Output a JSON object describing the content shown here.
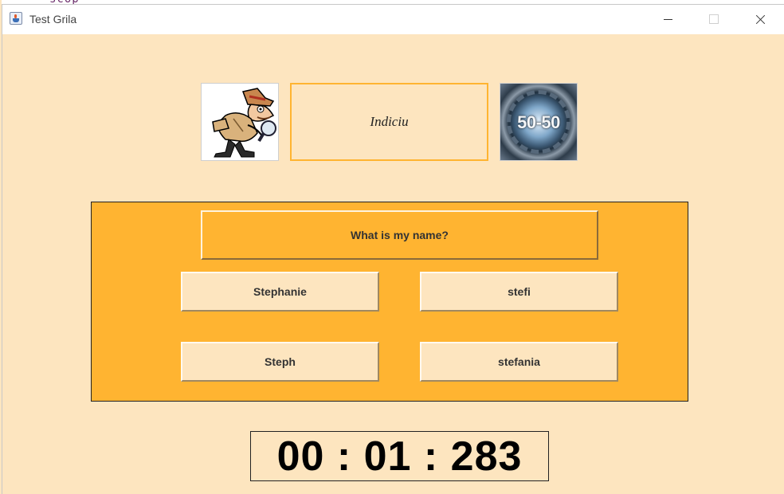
{
  "window": {
    "title": "Test Grila",
    "app_icon": "java-cup-icon"
  },
  "hint": {
    "icon": "detective-icon",
    "label": "Indiciu"
  },
  "fifty_fifty": {
    "icon": "fifty-fifty-icon",
    "label": "50-50"
  },
  "quiz": {
    "question": "What is my name?",
    "answers": [
      "Stephanie",
      "stefi",
      "Steph",
      "stefania"
    ]
  },
  "timer": {
    "value": "00 : 01 : 283"
  },
  "colors": {
    "background": "#fde5bf",
    "panel": "#ffb431",
    "hint_border": "#ffb431"
  }
}
